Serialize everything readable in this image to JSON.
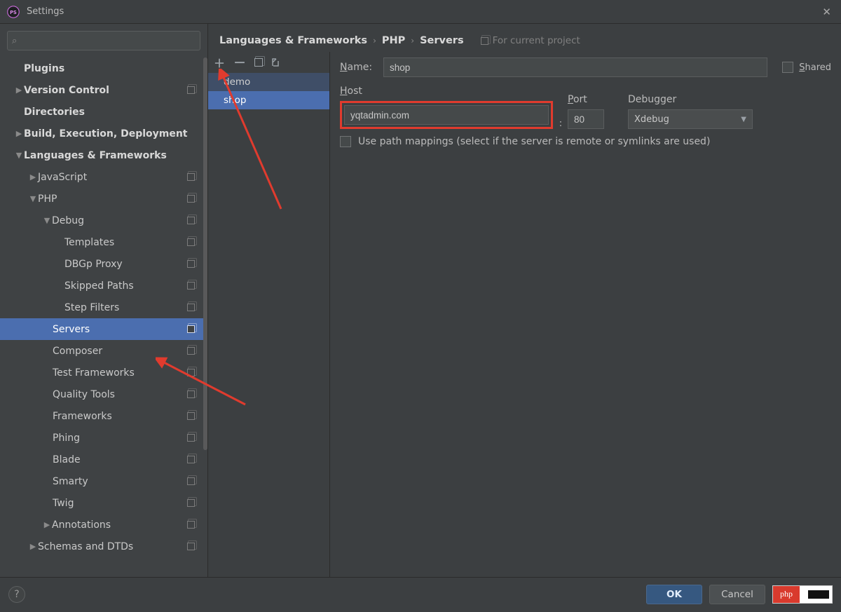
{
  "window": {
    "title": "Settings"
  },
  "breadcrumb": {
    "a": "Languages & Frameworks",
    "b": "PHP",
    "c": "Servers",
    "for": "For current project"
  },
  "sidebar": {
    "items": [
      {
        "label": "Plugins",
        "indent": 34,
        "bold": true,
        "arrow": "",
        "icon": false
      },
      {
        "label": "Version Control",
        "indent": 20,
        "bold": true,
        "arrow": "▶",
        "icon": true
      },
      {
        "label": "Directories",
        "indent": 34,
        "bold": true,
        "arrow": "",
        "icon": false
      },
      {
        "label": "Build, Execution, Deployment",
        "indent": 20,
        "bold": true,
        "arrow": "▶",
        "icon": false
      },
      {
        "label": "Languages & Frameworks",
        "indent": 20,
        "bold": true,
        "arrow": "▼",
        "icon": false
      },
      {
        "label": "JavaScript",
        "indent": 40,
        "bold": false,
        "arrow": "▶",
        "icon": true
      },
      {
        "label": "PHP",
        "indent": 40,
        "bold": false,
        "arrow": "▼",
        "icon": true
      },
      {
        "label": "Debug",
        "indent": 60,
        "bold": false,
        "arrow": "▼",
        "icon": true
      },
      {
        "label": "Templates",
        "indent": 92,
        "bold": false,
        "arrow": "",
        "icon": true
      },
      {
        "label": "DBGp Proxy",
        "indent": 92,
        "bold": false,
        "arrow": "",
        "icon": true
      },
      {
        "label": "Skipped Paths",
        "indent": 92,
        "bold": false,
        "arrow": "",
        "icon": true
      },
      {
        "label": "Step Filters",
        "indent": 92,
        "bold": false,
        "arrow": "",
        "icon": true
      },
      {
        "label": "Servers",
        "indent": 75,
        "bold": false,
        "arrow": "",
        "icon": true,
        "selected": true
      },
      {
        "label": "Composer",
        "indent": 75,
        "bold": false,
        "arrow": "",
        "icon": true
      },
      {
        "label": "Test Frameworks",
        "indent": 75,
        "bold": false,
        "arrow": "",
        "icon": true
      },
      {
        "label": "Quality Tools",
        "indent": 75,
        "bold": false,
        "arrow": "",
        "icon": true
      },
      {
        "label": "Frameworks",
        "indent": 75,
        "bold": false,
        "arrow": "",
        "icon": true
      },
      {
        "label": "Phing",
        "indent": 75,
        "bold": false,
        "arrow": "",
        "icon": true
      },
      {
        "label": "Blade",
        "indent": 75,
        "bold": false,
        "arrow": "",
        "icon": true
      },
      {
        "label": "Smarty",
        "indent": 75,
        "bold": false,
        "arrow": "",
        "icon": true
      },
      {
        "label": "Twig",
        "indent": 75,
        "bold": false,
        "arrow": "",
        "icon": true
      },
      {
        "label": "Annotations",
        "indent": 60,
        "bold": false,
        "arrow": "▶",
        "icon": true
      },
      {
        "label": "Schemas and DTDs",
        "indent": 40,
        "bold": false,
        "arrow": "▶",
        "icon": true
      }
    ]
  },
  "servers": {
    "items": [
      {
        "label": "demo",
        "selected": false
      },
      {
        "label": "shop",
        "selected": true
      }
    ]
  },
  "form": {
    "name_label": "Name:",
    "name_value": "shop",
    "shared_label": "Shared",
    "host_label": "Host",
    "host_value": "yqtadmin.com",
    "port_label": "Port",
    "port_value": "80",
    "debugger_label": "Debugger",
    "debugger_value": "Xdebug",
    "colon": ":",
    "path_label": "Use path mappings (select if the server is remote or symlinks are used)"
  },
  "footer": {
    "ok": "OK",
    "cancel": "Cancel",
    "help": "?",
    "badge": "php"
  }
}
